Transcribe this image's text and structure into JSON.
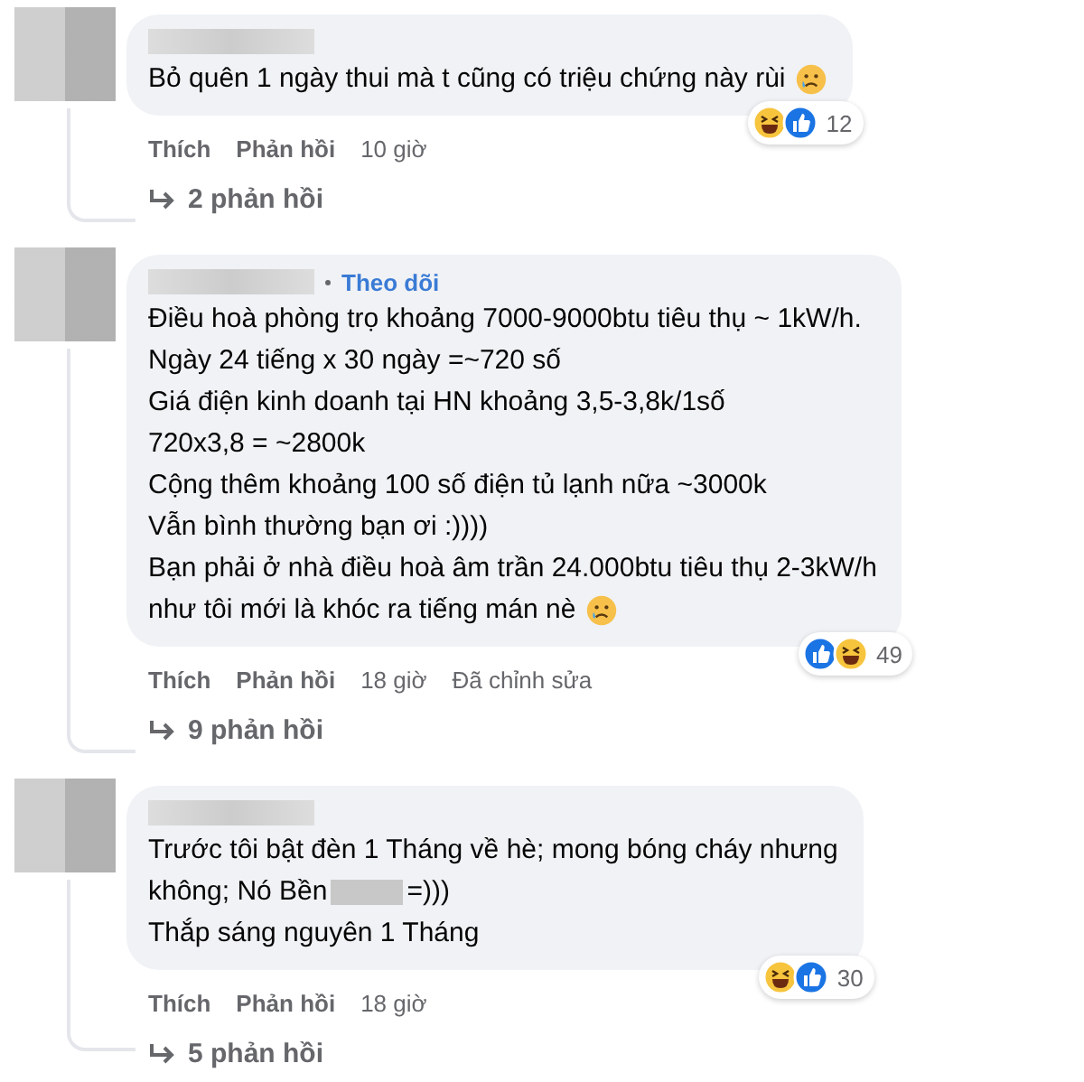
{
  "comments": [
    {
      "lines": [
        [
          "Bỏ quên 1 ngày thui mà t cũng có triệu chứng này rùi"
        ]
      ],
      "emoji_at_end": true,
      "reactions": {
        "icons": [
          {
            "kind": "haha"
          },
          {
            "kind": "like"
          }
        ],
        "count": "12"
      },
      "actions": {
        "like": "Thích",
        "reply": "Phản hồi",
        "time": "10 giờ"
      },
      "replies": "2 phản hồi"
    },
    {
      "follow_link": "Theo dõi",
      "lines": [
        [
          "Điều hoà phòng trọ khoảng 7000-9000btu tiêu thụ ~ 1kW/h."
        ],
        [
          "Ngày 24 tiếng x 30 ngày =~720 số"
        ],
        [
          "Giá điện kinh doanh tại HN khoảng 3,5-3,8k/1số"
        ],
        [
          "720x3,8 = ~2800k"
        ],
        [
          "Cộng thêm khoảng 100 số điện tủ lạnh nữa ~3000k"
        ],
        [
          "Vẫn bình thường bạn ơi :))))"
        ],
        [
          "Bạn phải ở nhà điều hoà âm trần 24.000btu tiêu thụ 2-3kW/h"
        ],
        [
          "như tôi mới là khóc ra tiếng mán nè"
        ]
      ],
      "emoji_at_end": true,
      "reactions": {
        "icons": [
          {
            "kind": "like"
          },
          {
            "kind": "haha"
          }
        ],
        "count": "49"
      },
      "actions": {
        "like": "Thích",
        "reply": "Phản hồi",
        "time": "18 giờ",
        "edited": "Đã chỉnh sửa"
      },
      "replies": "9 phản hồi"
    },
    {
      "lines": [
        [
          "Trước tôi bật đèn 1 Tháng về hè; mong bóng cháy nhưng"
        ],
        [
          "không; Nó Bền",
          "=)))"
        ],
        [
          "Thắp sáng nguyên 1 Tháng"
        ]
      ],
      "reactions": {
        "icons": [
          {
            "kind": "haha"
          },
          {
            "kind": "like"
          }
        ],
        "count": "30"
      },
      "actions": {
        "like": "Thích",
        "reply": "Phản hồi",
        "time": "18 giờ"
      },
      "replies": "5 phản hồi"
    }
  ]
}
